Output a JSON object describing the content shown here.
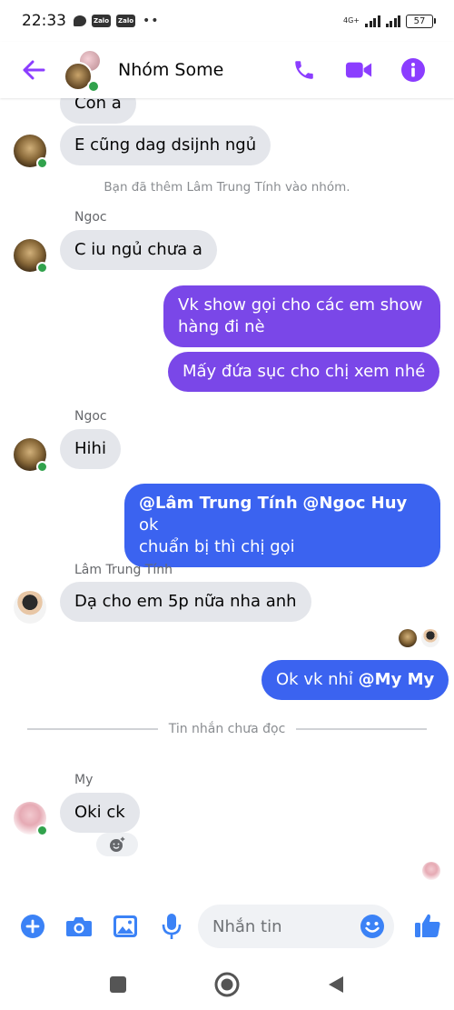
{
  "status_bar": {
    "time": "22:33",
    "app_icons": [
      "chat-bubble-icon",
      "zalo-icon",
      "zalo-icon"
    ],
    "zalo_label": "Zalo",
    "more_dots": "••",
    "network": "4G+",
    "battery": "57"
  },
  "header": {
    "title": "Nhóm Some",
    "accent_color": "#8b3dff"
  },
  "messages": {
    "partial_top": "Con a",
    "m1": "E cũng dag dsijnh ngủ",
    "system_note": "Bạn đã thêm Lâm Trung Tính vào nhóm.",
    "sender_ngoc": "Ngoc",
    "m2": "C iu ngủ chưa a",
    "out1": "Vk show gọi cho các em show hàng đi nè",
    "out2": "Mấy đứa sục cho chị xem nhé",
    "m3": "Hihi",
    "out3_mention1": "@Lâm Trung Tính",
    "out3_mention2": "@Ngoc Huy",
    "out3_text_a": " ok",
    "out3_text_b": "chuẩn bị thì chị gọi",
    "sender_lam": "Lâm Trung Tính",
    "m4": "Dạ cho em 5p nữa nha anh",
    "out4_text": "Ok vk nhỉ ",
    "out4_mention": "@My My",
    "divider": "Tin nhắn chưa đọc",
    "sender_my": "My",
    "m5": "Oki ck"
  },
  "composer": {
    "placeholder": "Nhắn tin"
  },
  "colors": {
    "bubble_purple": "#7a47e8",
    "bubble_blue": "#3b63f0",
    "bubble_incoming": "#e4e6eb",
    "online": "#31a24c"
  }
}
